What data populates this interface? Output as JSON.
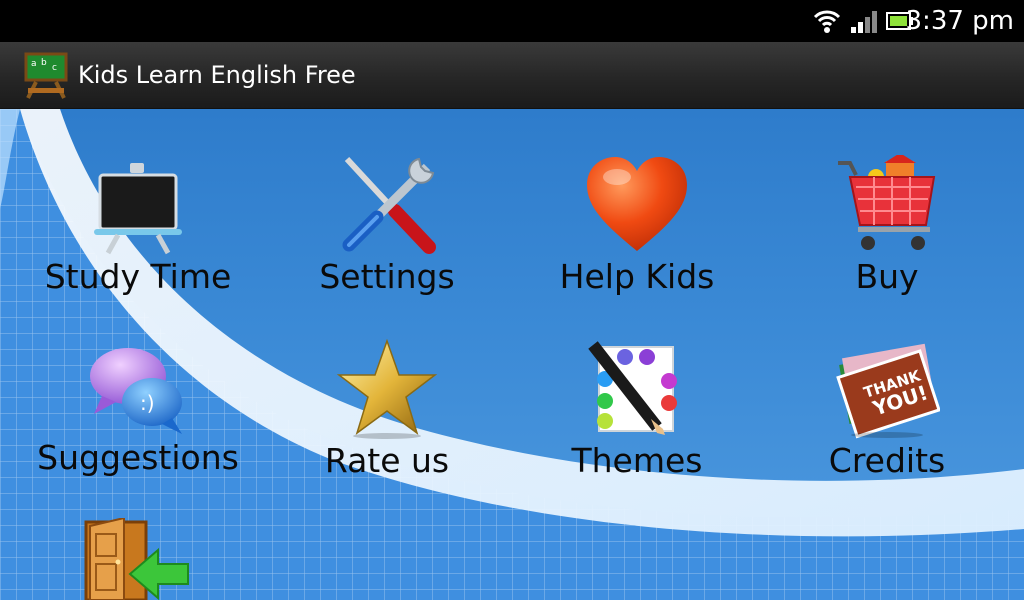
{
  "status_bar": {
    "time": "3:37 pm",
    "icons": [
      "wifi-icon",
      "signal-icon",
      "battery-icon"
    ]
  },
  "app_bar": {
    "title": "Kids Learn English Free",
    "icon": "chalkboard-abc-icon"
  },
  "menu": {
    "items": [
      {
        "label": "Study Time",
        "icon": "blackboard-icon"
      },
      {
        "label": "Settings",
        "icon": "tools-icon"
      },
      {
        "label": "Help Kids",
        "icon": "heart-icon"
      },
      {
        "label": "Buy",
        "icon": "shopping-cart-icon"
      },
      {
        "label": "Suggestions",
        "icon": "chat-bubbles-icon"
      },
      {
        "label": "Rate us",
        "icon": "star-icon"
      },
      {
        "label": "Themes",
        "icon": "palette-icon"
      },
      {
        "label": "Credits",
        "icon": "thank-you-cards-icon"
      }
    ]
  },
  "exit": {
    "icon": "exit-door-icon"
  },
  "colors": {
    "status_bar": "#000000",
    "app_bar": "#262626",
    "background": "#3b8ad6",
    "label": "#0a0a0a"
  }
}
